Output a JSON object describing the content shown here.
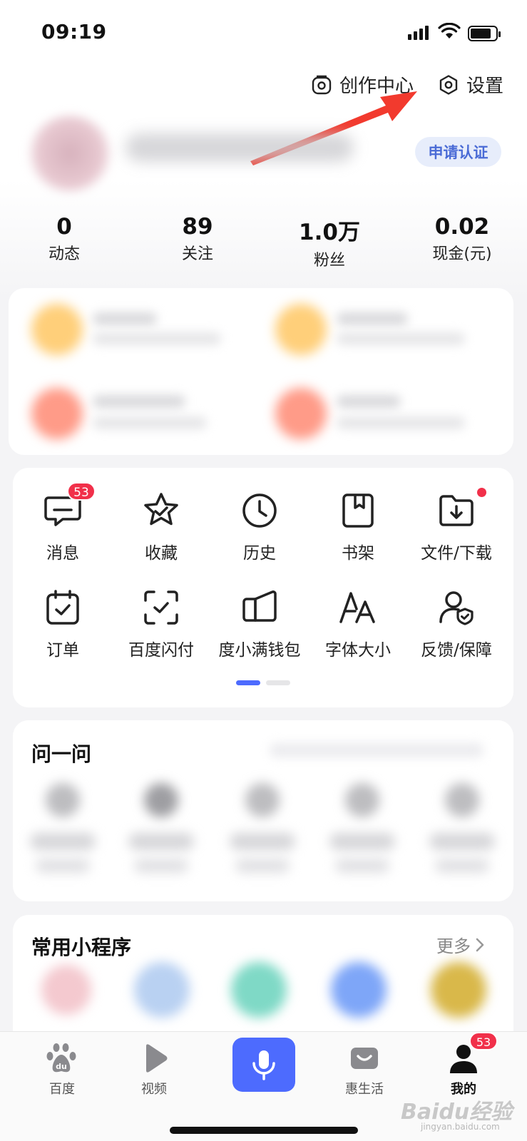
{
  "status_bar": {
    "time": "09:19"
  },
  "header": {
    "creator_center": "创作中心",
    "settings": "设置"
  },
  "profile": {
    "verify_button": "申请认证"
  },
  "stats": [
    {
      "value": "0",
      "label": "动态"
    },
    {
      "value": "89",
      "label": "关注"
    },
    {
      "value": "1.0万",
      "label": "粉丝"
    },
    {
      "value": "0.02",
      "label": "现金(元)"
    }
  ],
  "tools": [
    {
      "label": "消息",
      "icon": "message-icon",
      "badge": "53"
    },
    {
      "label": "收藏",
      "icon": "star-icon"
    },
    {
      "label": "历史",
      "icon": "clock-icon"
    },
    {
      "label": "书架",
      "icon": "bookshelf-icon"
    },
    {
      "label": "文件/下载",
      "icon": "folder-download-icon",
      "dot": true
    },
    {
      "label": "订单",
      "icon": "order-icon"
    },
    {
      "label": "百度闪付",
      "icon": "scan-pay-icon"
    },
    {
      "label": "度小满钱包",
      "icon": "wallet-icon"
    },
    {
      "label": "字体大小",
      "icon": "font-size-icon"
    },
    {
      "label": "反馈/保障",
      "icon": "feedback-shield-icon"
    }
  ],
  "pager": {
    "active_color": "#4d6bfe",
    "inactive_color": "#e6e6e8"
  },
  "ask_section": {
    "title": "问一问"
  },
  "mini_programs": {
    "title": "常用小程序",
    "more": "更多"
  },
  "tabbar": {
    "items": [
      {
        "label": "百度",
        "icon": "baidu-paw-icon"
      },
      {
        "label": "视频",
        "icon": "play-icon"
      },
      {
        "label": "",
        "icon": "microphone-icon"
      },
      {
        "label": "惠生活",
        "icon": "shopping-bag-icon"
      },
      {
        "label": "我的",
        "icon": "user-icon",
        "badge": "53",
        "active": true
      }
    ]
  },
  "watermark": {
    "text": "Baidu经验",
    "sub": "jingyan.baidu.com"
  },
  "colors": {
    "accent": "#4d6bfe",
    "badge": "#f1304a",
    "annotation_arrow": "#f23a2e"
  }
}
